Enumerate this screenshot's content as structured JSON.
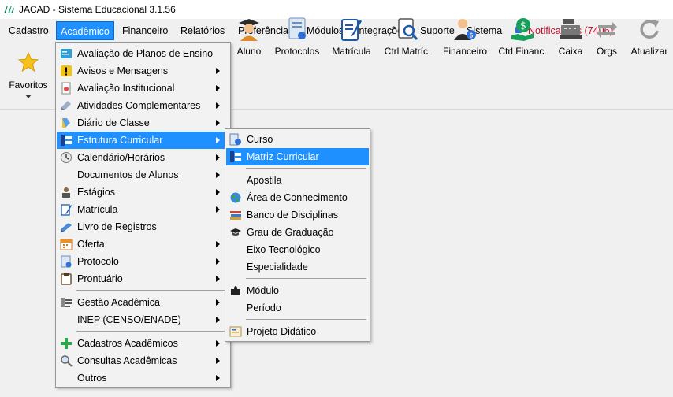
{
  "window": {
    "title": "JACAD - Sistema Educacional 3.1.56"
  },
  "menubar": {
    "items": [
      {
        "label": "Cadastro"
      },
      {
        "label": "Acadêmico"
      },
      {
        "label": "Financeiro"
      },
      {
        "label": "Relatórios"
      },
      {
        "label": "Preferências"
      },
      {
        "label": "Módulos"
      },
      {
        "label": "Integrações"
      },
      {
        "label": "Suporte"
      },
      {
        "label": "Sistema"
      }
    ],
    "notifications": "Notificações (7406)"
  },
  "toolbar": {
    "favorites": "Favoritos",
    "buttons": [
      {
        "label": "Aluno",
        "icon": "student-icon"
      },
      {
        "label": "Protocolos",
        "icon": "protocol-icon"
      },
      {
        "label": "Matrícula",
        "icon": "enrollment-icon"
      },
      {
        "label": "Ctrl Matríc.",
        "icon": "enrollment-control-icon"
      },
      {
        "label": "Financeiro",
        "icon": "financial-icon"
      },
      {
        "label": "Ctrl Financ.",
        "icon": "financial-control-icon"
      },
      {
        "label": "Caixa",
        "icon": "cash-register-icon"
      },
      {
        "label": "Orgs",
        "icon": "orgs-icon"
      },
      {
        "label": "Atualizar",
        "icon": "refresh-icon"
      }
    ]
  },
  "academic_menu": {
    "items": [
      {
        "label": "Avaliação de Planos de Ensino"
      },
      {
        "label": "Avisos e Mensagens"
      },
      {
        "label": "Avaliação Institucional"
      },
      {
        "label": "Atividades Complementares"
      },
      {
        "label": "Diário de Classe"
      },
      {
        "label": "Estrutura Curricular"
      },
      {
        "label": "Calendário/Horários"
      },
      {
        "label": "Documentos de Alunos"
      },
      {
        "label": "Estágios"
      },
      {
        "label": "Matrícula"
      },
      {
        "label": "Livro de Registros"
      },
      {
        "label": "Oferta"
      },
      {
        "label": "Protocolo"
      },
      {
        "label": "Prontuário"
      },
      {
        "label": "Gestão Acadêmica"
      },
      {
        "label": "INEP (CENSO/ENADE)"
      },
      {
        "label": "Cadastros Acadêmicos"
      },
      {
        "label": "Consultas Acadêmicas"
      },
      {
        "label": "Outros"
      }
    ]
  },
  "curriculum_submenu": {
    "items": [
      {
        "label": "Curso"
      },
      {
        "label": "Matriz Curricular"
      },
      {
        "label": "Apostila"
      },
      {
        "label": "Área de Conhecimento"
      },
      {
        "label": "Banco de Disciplinas"
      },
      {
        "label": "Grau de Graduação"
      },
      {
        "label": "Eixo Tecnológico"
      },
      {
        "label": "Especialidade"
      },
      {
        "label": "Módulo"
      },
      {
        "label": "Período"
      },
      {
        "label": "Projeto Didático"
      }
    ]
  },
  "colors": {
    "highlight": "#1e90ff",
    "notification": "#c8102e"
  }
}
